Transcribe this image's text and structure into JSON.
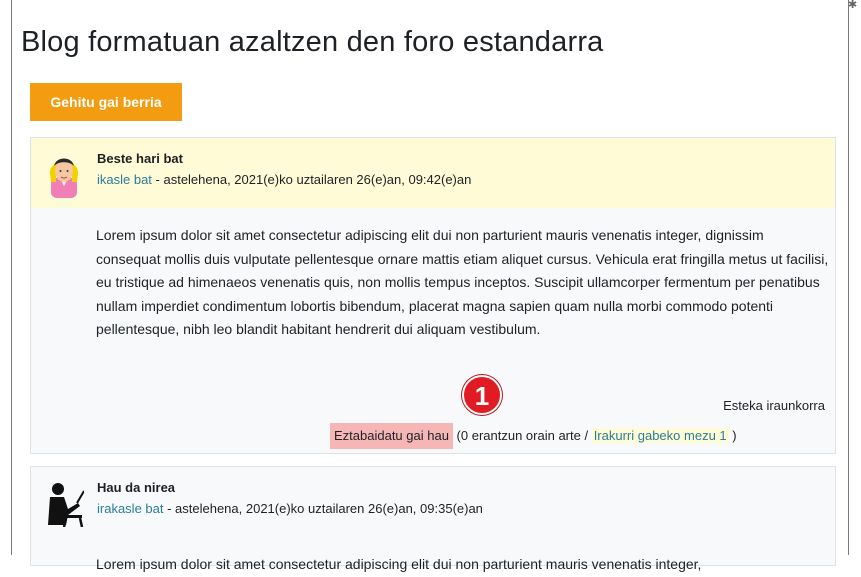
{
  "page": {
    "title": "Blog formatuan azaltzen den foro estandarra",
    "add_button_label": "Gehitu gai berria"
  },
  "posts": [
    {
      "subject": "Beste hari bat",
      "author": "ikasle bat",
      "date": " - astelehena, 2021(e)ko uztailaren 26(e)an, 09:42(e)an",
      "avatar": "student-avatar-icon",
      "body": "Lorem ipsum dolor sit amet consectetur adipiscing elit dui non parturient mauris venenatis integer, dignissim consequat mollis duis vulputate pellentesque ornare mattis etiam aliquet cursus. Vehicula erat fringilla metus ut facilisi, eu tristique ad himenaeos venenatis quis, non mollis tempus inceptos. Suscipit ullamcorper fermentum per penatibus nullam imperdiet condimentum lobortis bibendum, placerat magna sapien quam nulla morbi commodo potenti pellentesque, nibh leo blandit habitant hendrerit dui aliquam vestibulum.",
      "permalink_label": "Esteka iraunkorra",
      "discuss_label": "Eztabaidatu gai hau",
      "replies_text": " (0 erantzun orain arte / ",
      "unread_label": "Irakurri gabeko mezu 1",
      "replies_close": " )"
    },
    {
      "subject": "Hau da nirea",
      "author": "irakasle bat",
      "date": " - astelehena, 2021(e)ko uztailaren 26(e)an, 09:35(e)an",
      "avatar": "teacher-avatar-icon",
      "body": "Lorem ipsum dolor sit amet consectetur adipiscing elit dui non parturient mauris venenatis integer,"
    }
  ],
  "annotation": {
    "callout_number": "1",
    "highlight_color": "#f6b6b6",
    "callout_color": "#e01b24"
  },
  "colors": {
    "button": "#f39c12",
    "unread_highlight": "#fffbd6",
    "link": "#2a7d9c"
  }
}
